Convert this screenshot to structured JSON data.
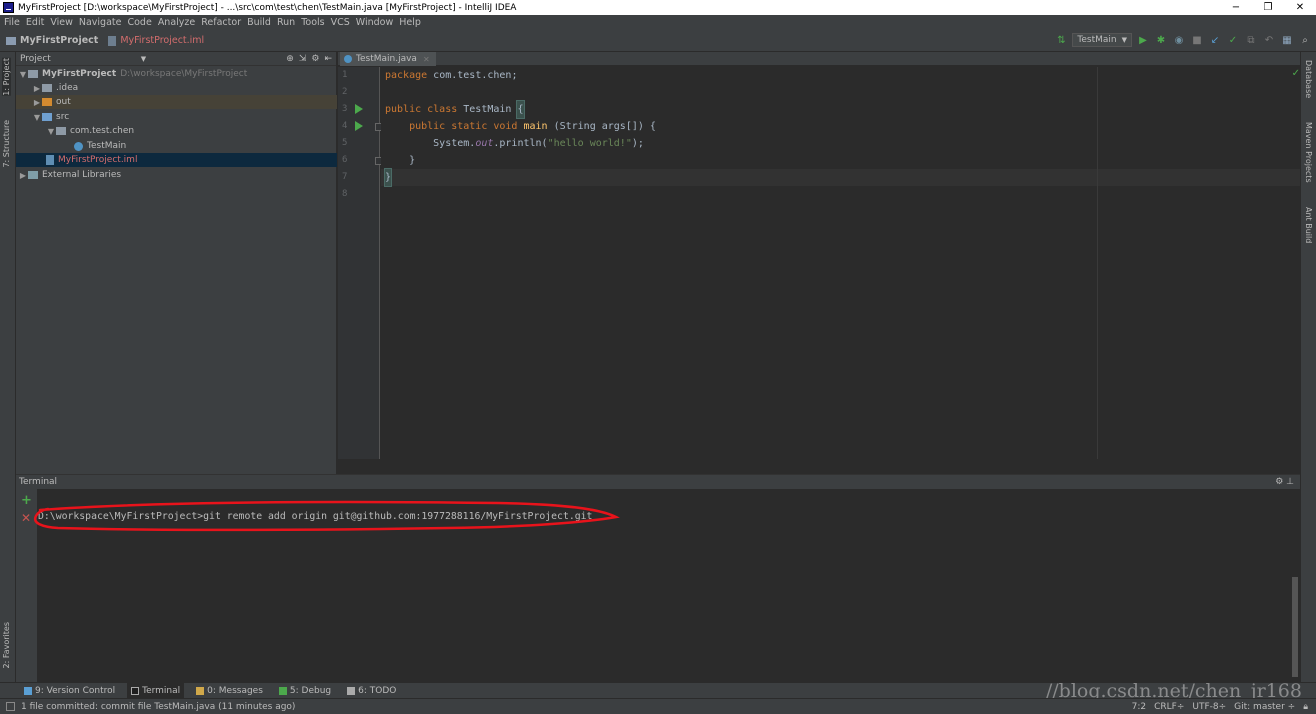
{
  "window": {
    "title": "MyFirstProject [D:\\workspace\\MyFirstProject] - ...\\src\\com\\test\\chen\\TestMain.java [MyFirstProject] - IntelliJ IDEA",
    "controls": [
      "−",
      "❐",
      "✕"
    ]
  },
  "menu": [
    "File",
    "Edit",
    "View",
    "Navigate",
    "Code",
    "Analyze",
    "Refactor",
    "Build",
    "Run",
    "Tools",
    "VCS",
    "Window",
    "Help"
  ],
  "nav": {
    "project": "MyFirstProject",
    "file": "MyFirstProject.iml",
    "run_config": "TestMain"
  },
  "left_tabs": {
    "project": "1: Project",
    "structure": "7: Structure",
    "favorites": "2: Favorites"
  },
  "right_tabs": {
    "database": "Database",
    "maven": "Maven Projects",
    "ant": "Ant Build"
  },
  "project_panel": {
    "title": "Project",
    "tree": [
      {
        "label": "MyFirstProject",
        "path": "D:\\workspace\\MyFirstProject",
        "arrow": "▼",
        "icon": "folder-icon"
      },
      {
        "label": ".idea",
        "arrow": "▶",
        "icon": "folder-icon"
      },
      {
        "label": "out",
        "arrow": "▶",
        "icon": "folder-icon"
      },
      {
        "label": "src",
        "arrow": "▼",
        "icon": "folder-icon"
      },
      {
        "label": "com.test.chen",
        "arrow": "▼",
        "icon": "package-icon"
      },
      {
        "label": "TestMain",
        "arrow": "",
        "icon": "class-icon"
      },
      {
        "label": "MyFirstProject.iml",
        "arrow": "",
        "icon": "module-file-icon"
      },
      {
        "label": "External Libraries",
        "arrow": "▶",
        "icon": "library-icon"
      }
    ]
  },
  "editor": {
    "tab": "TestMain.java",
    "line_numbers": [
      "1",
      "2",
      "3",
      "4",
      "5",
      "6",
      "7",
      "8"
    ],
    "code": {
      "l1_kw": "package",
      "l1_rest": " com.test.chen;",
      "l3_kw": "public class",
      "l3_rest": " TestMain ",
      "l3_brace": "{",
      "l4_kw": "    public static void",
      "l4_fn": " main",
      "l4_rest": " (String args[]) {",
      "l5_a": "        System.",
      "l5_out": "out",
      "l5_b": ".println(",
      "l5_str": "\"hello world!\"",
      "l5_c": ");",
      "l6": "    }",
      "l7": "}"
    }
  },
  "terminal": {
    "title": "Terminal",
    "command": "D:\\workspace\\MyFirstProject>git remote add origin git@github.com:1977288116/MyFirstProject.git"
  },
  "bottom_tabs": [
    "9: Version Control",
    "Terminal",
    "0: Messages",
    "5: Debug",
    "6: TODO"
  ],
  "status": {
    "message": "1 file committed: commit file TestMain.java (11 minutes ago)",
    "position": "7:2",
    "line_sep": "CRLF÷",
    "encoding": "UTF-8÷",
    "vcs": "Git: master ÷"
  },
  "watermark": "//blog.csdn.net/chen_jr168",
  "colors": {
    "annotation": "#e8131b",
    "keyword": "#cc7832",
    "string": "#6a8759",
    "accent_green": "#4ca94c"
  }
}
